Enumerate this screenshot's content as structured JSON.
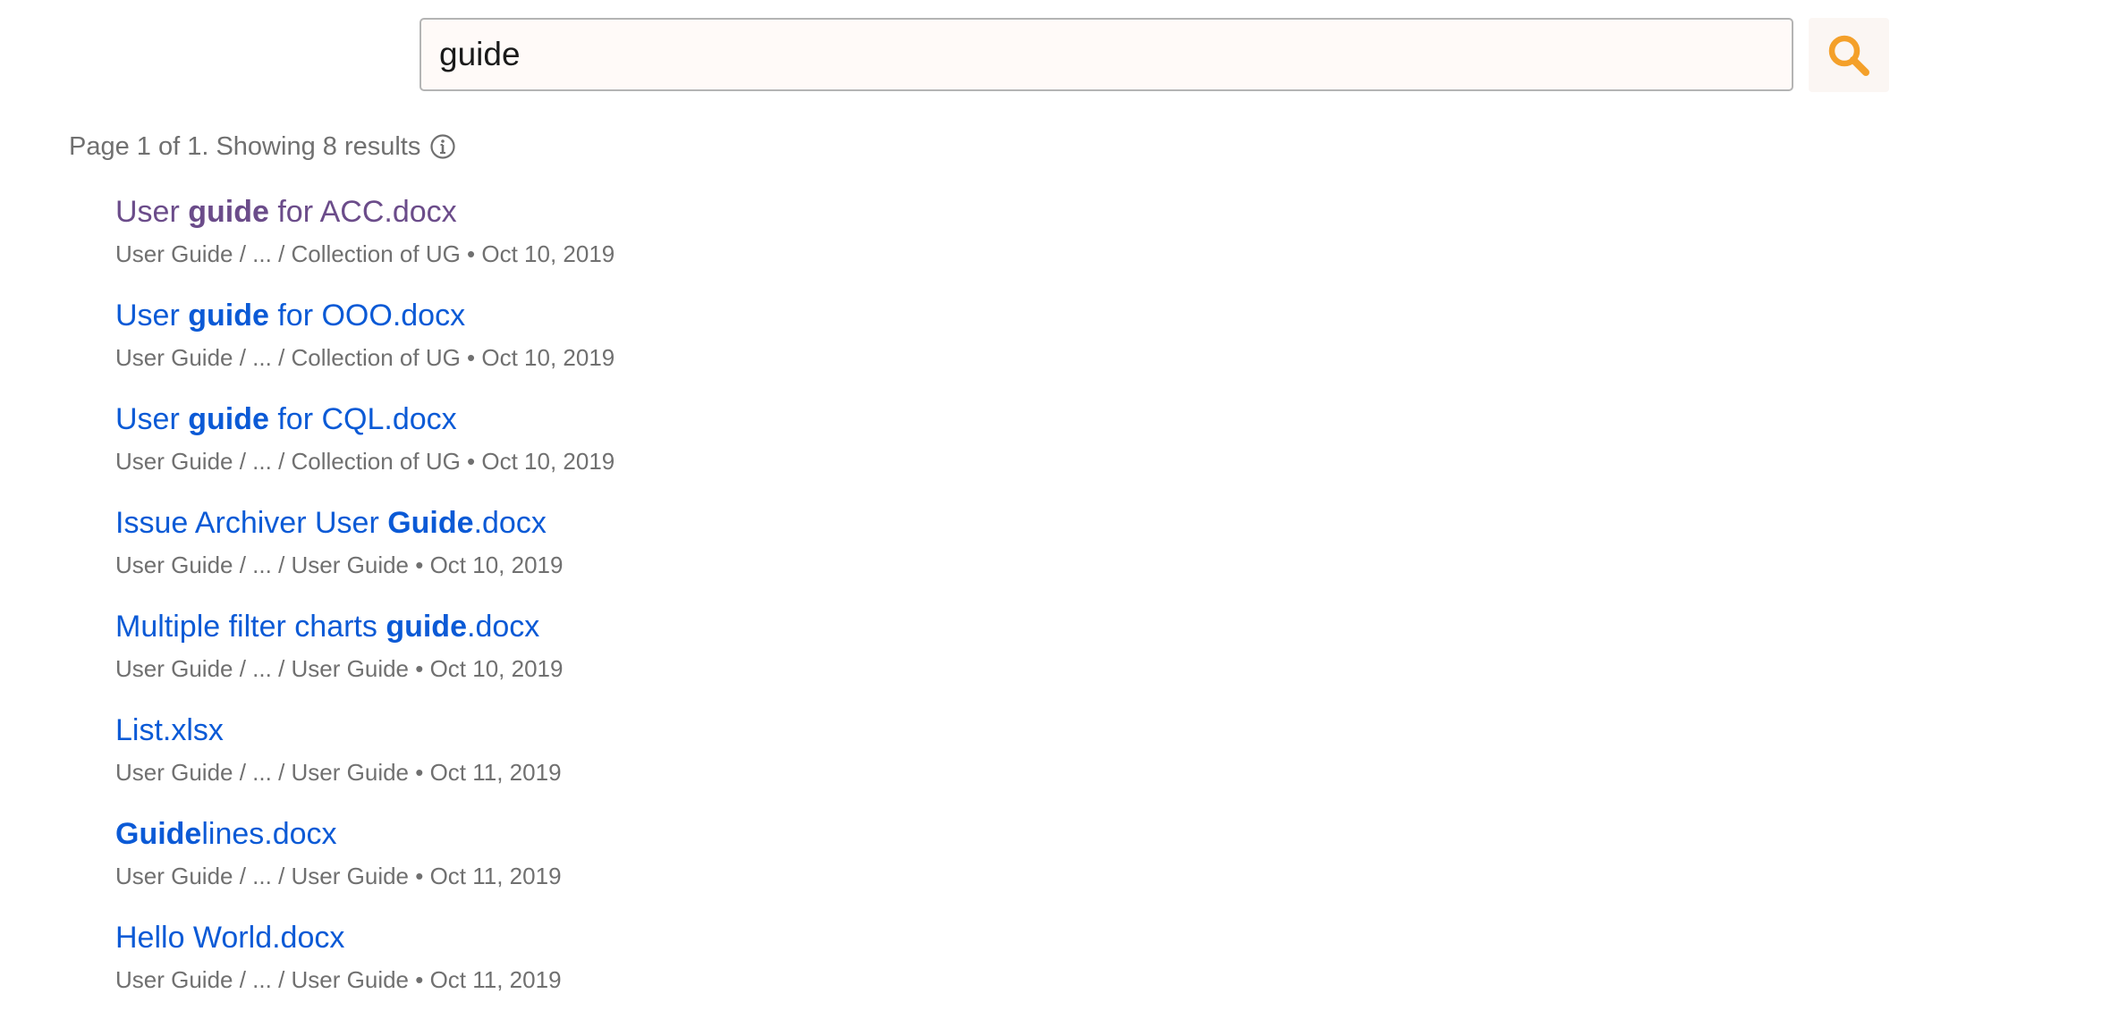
{
  "search": {
    "value": "guide",
    "button_icon": "search-icon",
    "button_color": "#f4a02a"
  },
  "summary": {
    "text": "Page 1 of 1. Showing 8 results",
    "icon": "info-icon"
  },
  "colors": {
    "link": "#0b5ad6",
    "visited_link": "#6b4c8a",
    "meta_text": "#707070"
  },
  "results": [
    {
      "title_parts": [
        {
          "text": "User ",
          "bold": false
        },
        {
          "text": "guide",
          "bold": true
        },
        {
          "text": " for ACC.docx",
          "bold": false
        }
      ],
      "visited": true,
      "space": "User Guide",
      "ellipsis": "...",
      "parent": "Collection of UG",
      "date": "Oct 10, 2019"
    },
    {
      "title_parts": [
        {
          "text": "User ",
          "bold": false
        },
        {
          "text": "guide",
          "bold": true
        },
        {
          "text": " for OOO.docx",
          "bold": false
        }
      ],
      "visited": false,
      "space": "User Guide",
      "ellipsis": "...",
      "parent": "Collection of UG",
      "date": "Oct 10, 2019"
    },
    {
      "title_parts": [
        {
          "text": "User ",
          "bold": false
        },
        {
          "text": "guide",
          "bold": true
        },
        {
          "text": " for CQL.docx",
          "bold": false
        }
      ],
      "visited": false,
      "space": "User Guide",
      "ellipsis": "...",
      "parent": "Collection of UG",
      "date": "Oct 10, 2019"
    },
    {
      "title_parts": [
        {
          "text": "Issue Archiver User ",
          "bold": false
        },
        {
          "text": "Guide",
          "bold": true
        },
        {
          "text": ".docx",
          "bold": false
        }
      ],
      "visited": false,
      "space": "User Guide",
      "ellipsis": "...",
      "parent": "User Guide",
      "date": "Oct 10, 2019"
    },
    {
      "title_parts": [
        {
          "text": "Multiple filter charts ",
          "bold": false
        },
        {
          "text": "guide",
          "bold": true
        },
        {
          "text": ".docx",
          "bold": false
        }
      ],
      "visited": false,
      "space": "User Guide",
      "ellipsis": "...",
      "parent": "User Guide",
      "date": "Oct 10, 2019"
    },
    {
      "title_parts": [
        {
          "text": "List.xlsx",
          "bold": false
        }
      ],
      "visited": false,
      "space": "User Guide",
      "ellipsis": "...",
      "parent": "User Guide",
      "date": "Oct 11, 2019"
    },
    {
      "title_parts": [
        {
          "text": "Guide",
          "bold": true
        },
        {
          "text": "lines.docx",
          "bold": false
        }
      ],
      "visited": false,
      "space": "User Guide",
      "ellipsis": "...",
      "parent": "User Guide",
      "date": "Oct 11, 2019"
    },
    {
      "title_parts": [
        {
          "text": "Hello World.docx",
          "bold": false
        }
      ],
      "visited": false,
      "space": "User Guide",
      "ellipsis": "...",
      "parent": "User Guide",
      "date": "Oct 11, 2019"
    }
  ]
}
